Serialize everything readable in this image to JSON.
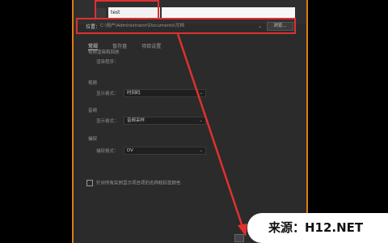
{
  "dialog": {
    "name_value": "test",
    "location_label": "位置：",
    "location_path": "C:\\用户\\Administrator\\Documents\\文档",
    "location_dropdown": "⌄",
    "browse_label": "浏览...",
    "tabs": [
      "常规",
      "暂存盘",
      "项目设置"
    ],
    "sections": {
      "top": "视频渲染和回放",
      "renderer_label": "渲染程序：",
      "video": "视频",
      "video_label": "显示格式：",
      "video_value": "时间码",
      "audio": "音频",
      "audio_label": "显示格式：",
      "audio_value": "音频采样",
      "capture": "捕捉",
      "capture_label": "捕捉格式：",
      "capture_value": "DV"
    },
    "checkbox_label": "针对所有实例显示项目项的名称和标签颜色"
  },
  "watermark": "来源：H12.NET",
  "colors": {
    "accent": "#e07a10",
    "highlight": "#e03030",
    "background": "#000000"
  }
}
